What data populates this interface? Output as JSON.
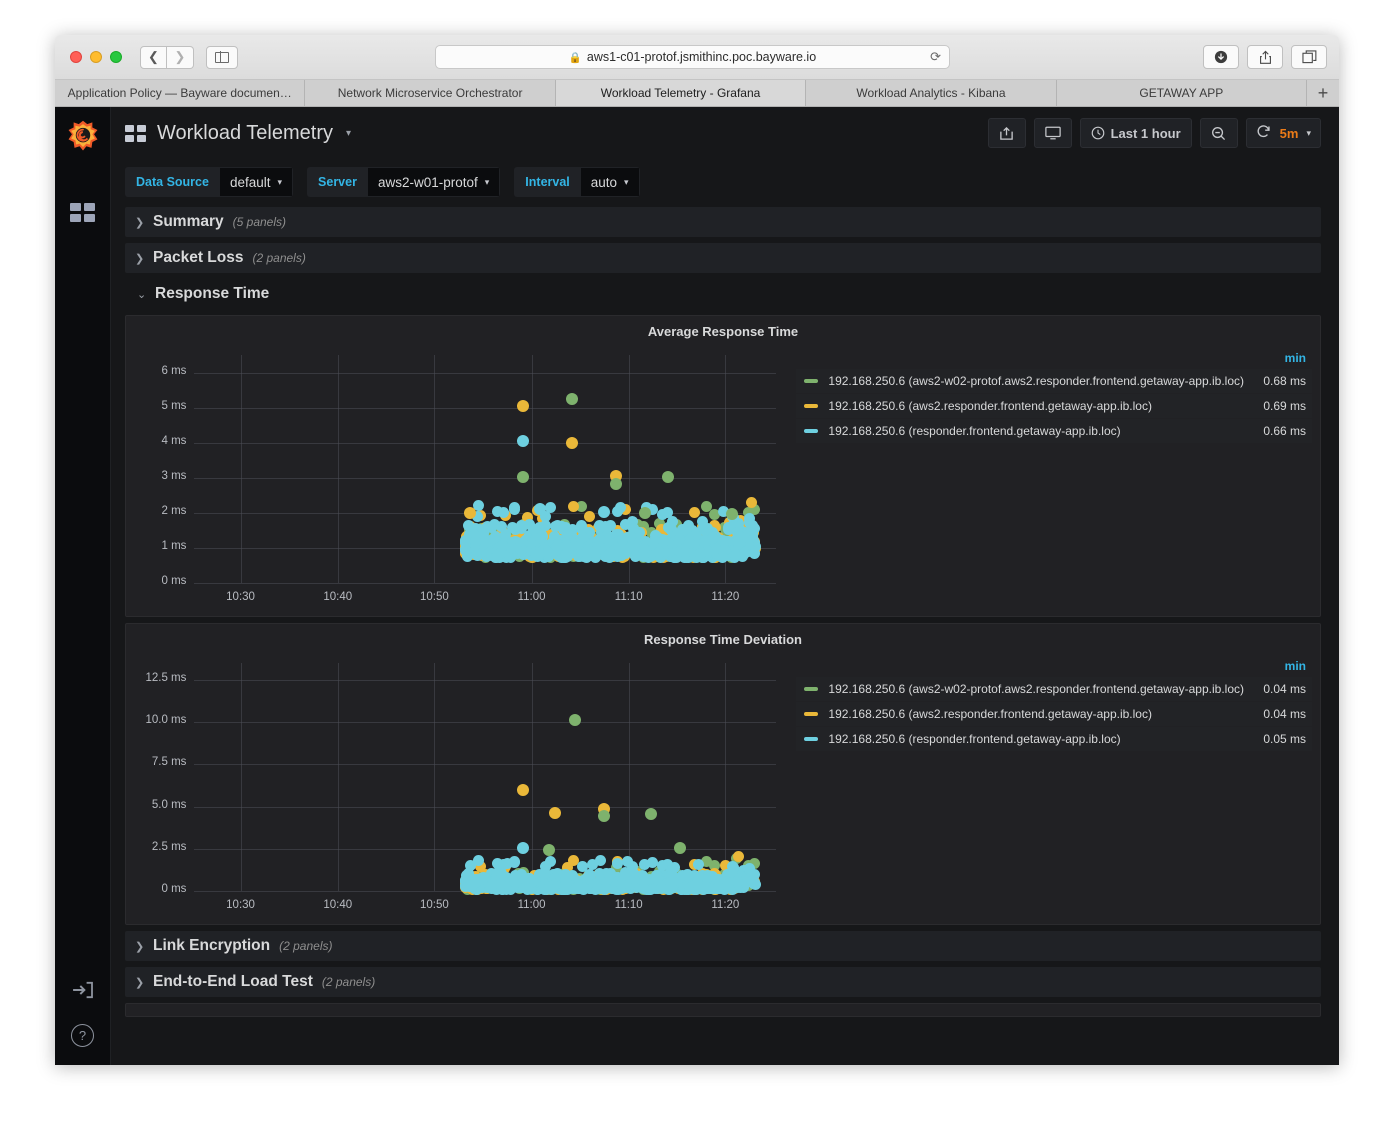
{
  "browser": {
    "url": "aws1-c01-protof.jsmithinc.poc.bayware.io",
    "lock_icon": "lock-icon",
    "reload_icon": "reload-icon",
    "back_icon": "chevron-left-icon",
    "forward_icon": "chevron-right-icon",
    "sidebar_icon": "sidebar-toggle-icon",
    "download_icon": "download-icon",
    "share_icon": "share-icon",
    "tabs_icon": "tab-overview-icon",
    "new_tab_label": "+",
    "tabs": [
      {
        "label": "Application Policy — Bayware documen…",
        "active": false
      },
      {
        "label": "Network Microservice Orchestrator",
        "active": false
      },
      {
        "label": "Workload Telemetry - Grafana",
        "active": true
      },
      {
        "label": "Workload Analytics - Kibana",
        "active": false
      },
      {
        "label": "GETAWAY APP",
        "active": false
      }
    ]
  },
  "sidebar": {
    "logo": "grafana-logo-icon",
    "items": [
      {
        "name": "dashboards-icon"
      }
    ],
    "bottom": [
      {
        "name": "sign-in-icon"
      },
      {
        "name": "help-icon",
        "label": "?"
      }
    ]
  },
  "header": {
    "dashboard_icon": "dashboard-grid-icon",
    "title": "Workload Telemetry",
    "title_caret": "▾",
    "actions": [
      {
        "name": "share-dashboard-button",
        "icon": "share-icon"
      },
      {
        "name": "tv-mode-button",
        "icon": "monitor-icon"
      }
    ],
    "time_range": {
      "icon": "clock-icon",
      "label": "Last 1 hour"
    },
    "zoom_out": {
      "icon": "zoom-out-icon"
    },
    "refresh": {
      "icon": "refresh-icon",
      "interval": "5m",
      "caret": "▾"
    }
  },
  "variables": [
    {
      "label": "Data Source",
      "value": "default",
      "caret": "▾"
    },
    {
      "label": "Server",
      "value": "aws2-w01-protof",
      "caret": "▾"
    },
    {
      "label": "Interval",
      "value": "auto",
      "caret": "▾"
    }
  ],
  "rows": [
    {
      "name": "Summary",
      "count": "(5 panels)",
      "collapsed": true,
      "chevron": "❯"
    },
    {
      "name": "Packet Loss",
      "count": "(2 panels)",
      "collapsed": true,
      "chevron": "❯"
    },
    {
      "name": "Response Time",
      "count": "",
      "collapsed": false,
      "chevron": "⌄"
    },
    {
      "name": "Link Encryption",
      "count": "(2 panels)",
      "collapsed": true,
      "chevron": "❯"
    },
    {
      "name": "End-to-End Load Test",
      "count": "(2 panels)",
      "collapsed": true,
      "chevron": "❯"
    }
  ],
  "colors": {
    "green": "#7EB26D",
    "orange": "#EAB839",
    "cyan": "#6ED0E0",
    "accent_blue": "#33b5e5",
    "accent_orange": "#eb7b18",
    "panel_bg": "#212124",
    "app_bg": "#161719"
  },
  "chart_data": [
    {
      "type": "scatter",
      "title": "Average Response Time",
      "xlabel": "",
      "ylabel": "",
      "ylim": [
        0,
        6.5
      ],
      "yticks": [
        "0 ms",
        "1 ms",
        "2 ms",
        "3 ms",
        "4 ms",
        "5 ms",
        "6 ms"
      ],
      "ytick_values": [
        0,
        1,
        2,
        3,
        4,
        5,
        6
      ],
      "xticks": [
        "10:30",
        "10:40",
        "10:50",
        "11:00",
        "11:10",
        "11:20"
      ],
      "xtick_values": [
        10.5,
        10.667,
        10.833,
        11.0,
        11.167,
        11.333
      ],
      "xlim": [
        10.42,
        11.42
      ],
      "grid": true,
      "legend_position": "right",
      "legend_header": "min",
      "series": [
        {
          "name": "192.168.250.6 (aws2-w02-protof.aws2.responder.frontend.getaway-app.ib.loc)",
          "color": "#7EB26D",
          "min": "0.68 ms"
        },
        {
          "name": "192.168.250.6 (aws2.responder.frontend.getaway-app.ib.loc)",
          "color": "#EAB839",
          "min": "0.69 ms"
        },
        {
          "name": "192.168.250.6 (responder.frontend.getaway-app.ib.loc)",
          "color": "#6ED0E0",
          "min": "0.66 ms"
        }
      ],
      "outliers": [
        {
          "x": 10.985,
          "y": 5.05,
          "c": "#EAB839"
        },
        {
          "x": 11.07,
          "y": 5.25,
          "c": "#7EB26D"
        },
        {
          "x": 10.985,
          "y": 4.05,
          "c": "#6ED0E0"
        },
        {
          "x": 11.07,
          "y": 4.0,
          "c": "#EAB839"
        },
        {
          "x": 10.985,
          "y": 3.02,
          "c": "#7EB26D"
        },
        {
          "x": 11.145,
          "y": 3.05,
          "c": "#EAB839"
        },
        {
          "x": 11.145,
          "y": 2.82,
          "c": "#7EB26D"
        },
        {
          "x": 11.235,
          "y": 3.02,
          "c": "#7EB26D"
        },
        {
          "x": 10.895,
          "y": 2.0,
          "c": "#EAB839"
        },
        {
          "x": 11.015,
          "y": 2.1,
          "c": "#6ED0E0"
        },
        {
          "x": 11.125,
          "y": 2.03,
          "c": "#6ED0E0"
        },
        {
          "x": 11.195,
          "y": 2.0,
          "c": "#7EB26D"
        },
        {
          "x": 11.345,
          "y": 1.97,
          "c": "#7EB26D"
        }
      ]
    },
    {
      "type": "scatter",
      "title": "Response Time Deviation",
      "xlabel": "",
      "ylabel": "",
      "ylim": [
        0,
        13.5
      ],
      "yticks": [
        "0 ms",
        "2.5 ms",
        "5.0 ms",
        "7.5 ms",
        "10.0 ms",
        "12.5 ms"
      ],
      "ytick_values": [
        0,
        2.5,
        5.0,
        7.5,
        10.0,
        12.5
      ],
      "xticks": [
        "10:30",
        "10:40",
        "10:50",
        "11:00",
        "11:10",
        "11:20"
      ],
      "xtick_values": [
        10.5,
        10.667,
        10.833,
        11.0,
        11.167,
        11.333
      ],
      "xlim": [
        10.42,
        11.42
      ],
      "grid": true,
      "legend_position": "right",
      "legend_header": "min",
      "series": [
        {
          "name": "192.168.250.6 (aws2-w02-protof.aws2.responder.frontend.getaway-app.ib.loc)",
          "color": "#7EB26D",
          "min": "0.04 ms"
        },
        {
          "name": "192.168.250.6 (aws2.responder.frontend.getaway-app.ib.loc)",
          "color": "#EAB839",
          "min": "0.04 ms"
        },
        {
          "name": "192.168.250.6 (responder.frontend.getaway-app.ib.loc)",
          "color": "#6ED0E0",
          "min": "0.05 ms"
        }
      ],
      "outliers": [
        {
          "x": 11.075,
          "y": 10.1,
          "c": "#7EB26D"
        },
        {
          "x": 10.985,
          "y": 6.0,
          "c": "#EAB839"
        },
        {
          "x": 11.04,
          "y": 4.6,
          "c": "#EAB839"
        },
        {
          "x": 11.125,
          "y": 4.85,
          "c": "#EAB839"
        },
        {
          "x": 11.125,
          "y": 4.45,
          "c": "#7EB26D"
        },
        {
          "x": 11.205,
          "y": 4.55,
          "c": "#7EB26D"
        },
        {
          "x": 10.985,
          "y": 2.55,
          "c": "#6ED0E0"
        },
        {
          "x": 11.03,
          "y": 2.45,
          "c": "#7EB26D"
        },
        {
          "x": 11.255,
          "y": 2.55,
          "c": "#7EB26D"
        }
      ]
    }
  ]
}
